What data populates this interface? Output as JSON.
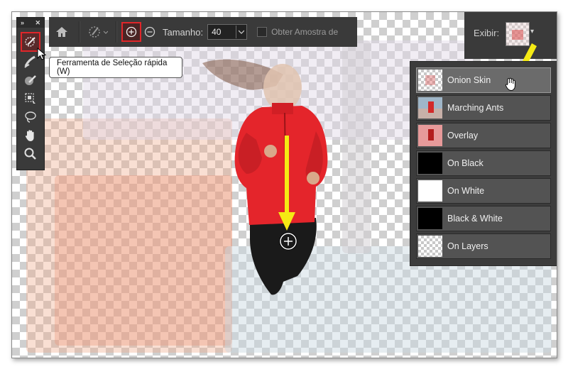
{
  "options_bar": {
    "size_label": "Tamanho:",
    "size_value": "40",
    "sample_all_label": "Obter Amostra de",
    "view_label": "Exibir:"
  },
  "tools_panel": {
    "tools": [
      "quick-selection",
      "refine-edge-brush",
      "brush",
      "object-selection",
      "lasso",
      "hand",
      "zoom"
    ]
  },
  "tooltip": "Ferramenta de Seleção rápida (W)",
  "view_modes": [
    {
      "label": "Onion Skin",
      "selected": true
    },
    {
      "label": "Marching Ants",
      "selected": false
    },
    {
      "label": "Overlay",
      "selected": false
    },
    {
      "label": "On Black",
      "selected": false
    },
    {
      "label": "On White",
      "selected": false
    },
    {
      "label": "Black & White",
      "selected": false
    },
    {
      "label": "On Layers",
      "selected": false
    }
  ],
  "colors": {
    "highlight": "#e0262a",
    "jacket": "#e4252b",
    "arrow": "#f5ea14",
    "panel": "#3a3a3a"
  }
}
